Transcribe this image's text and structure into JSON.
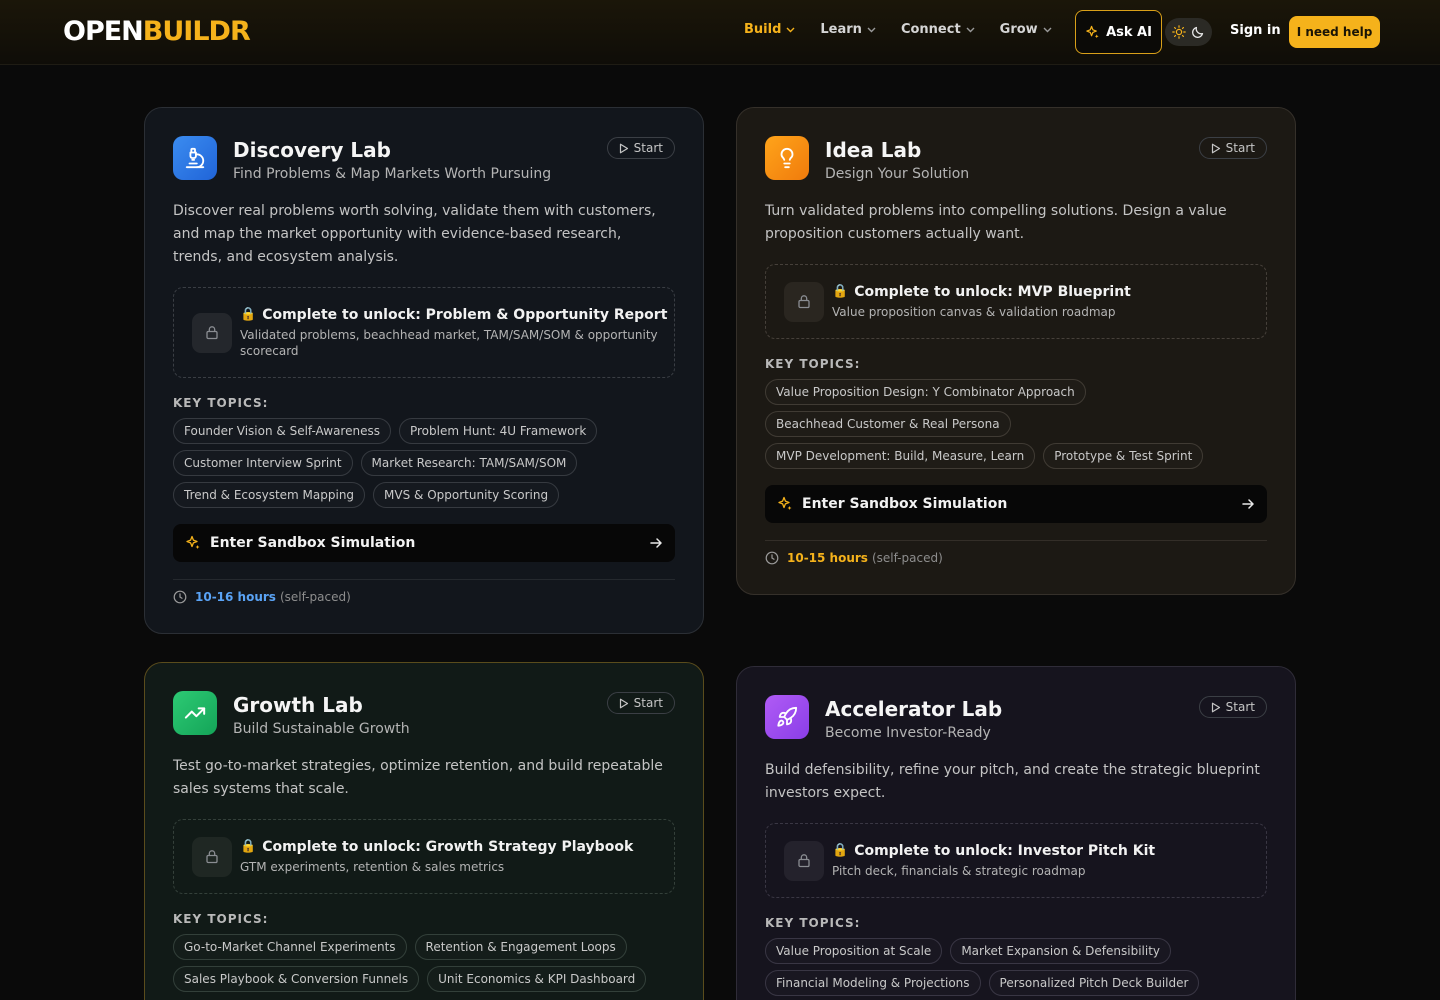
{
  "nav": {
    "logo_open": "OPEN",
    "logo_buildr": "BUILDR",
    "links": [
      {
        "label": "Build",
        "active": true
      },
      {
        "label": "Learn",
        "active": false
      },
      {
        "label": "Connect",
        "active": false
      },
      {
        "label": "Grow",
        "active": false
      }
    ],
    "ask_ai": "Ask AI",
    "sign_in": "Sign in",
    "help": "I need help",
    "accent_color": "#f5b21b"
  },
  "common": {
    "start": "Start",
    "key_topics": "KEY TOPICS:",
    "sandbox": "Enter Sandbox Simulation",
    "self_paced": "(self-paced)"
  },
  "cards": {
    "discovery": {
      "icon": "microscope-icon",
      "title": "Discovery Lab",
      "subtitle": "Find Problems & Map Markets Worth Pursuing",
      "description": "Discover real problems worth solving, validate them with customers, and map the market opportunity with evidence-based research, trends, and ecosystem analysis.",
      "unlock_title": "Complete to unlock: Problem & Opportunity Report",
      "unlock_desc": "Validated problems, beachhead market, TAM/SAM/SOM & opportunity scorecard",
      "topics": [
        "Founder Vision & Self-Awareness",
        "Problem Hunt: 4U Framework",
        "Customer Interview Sprint",
        "Market Research: TAM/SAM/SOM",
        "Trend & Ecosystem Mapping",
        "MVS & Opportunity Scoring"
      ],
      "hours": "10-16 hours"
    },
    "idea": {
      "icon": "lightbulb-icon",
      "title": "Idea Lab",
      "subtitle": "Design Your Solution",
      "description": "Turn validated problems into compelling solutions. Design a value proposition customers actually want.",
      "unlock_title": "Complete to unlock: MVP Blueprint",
      "unlock_desc": "Value proposition canvas & validation roadmap",
      "topics": [
        "Value Proposition Design: Y Combinator Approach",
        "Beachhead Customer & Real Persona",
        "MVP Development: Build, Measure, Learn",
        "Prototype & Test Sprint"
      ],
      "hours": "10-15 hours"
    },
    "growth": {
      "icon": "trending-up-icon",
      "title": "Growth Lab",
      "subtitle": "Build Sustainable Growth",
      "description": "Test go-to-market strategies, optimize retention, and build repeatable sales systems that scale.",
      "unlock_title": "Complete to unlock: Growth Strategy Playbook",
      "unlock_desc": "GTM experiments, retention & sales metrics",
      "topics": [
        "Go-to-Market Channel Experiments",
        "Retention & Engagement Loops",
        "Sales Playbook & Conversion Funnels",
        "Unit Economics & KPI Dashboard"
      ]
    },
    "accel": {
      "icon": "rocket-icon",
      "title": "Accelerator Lab",
      "subtitle": "Become Investor-Ready",
      "description": "Build defensibility, refine your pitch, and create the strategic blueprint investors expect.",
      "unlock_title": "Complete to unlock: Investor Pitch Kit",
      "unlock_desc": "Pitch deck, financials & strategic roadmap",
      "topics": [
        "Value Proposition at Scale",
        "Market Expansion & Defensibility",
        "Financial Modeling & Projections",
        "Personalized Pitch Deck Builder"
      ]
    }
  }
}
